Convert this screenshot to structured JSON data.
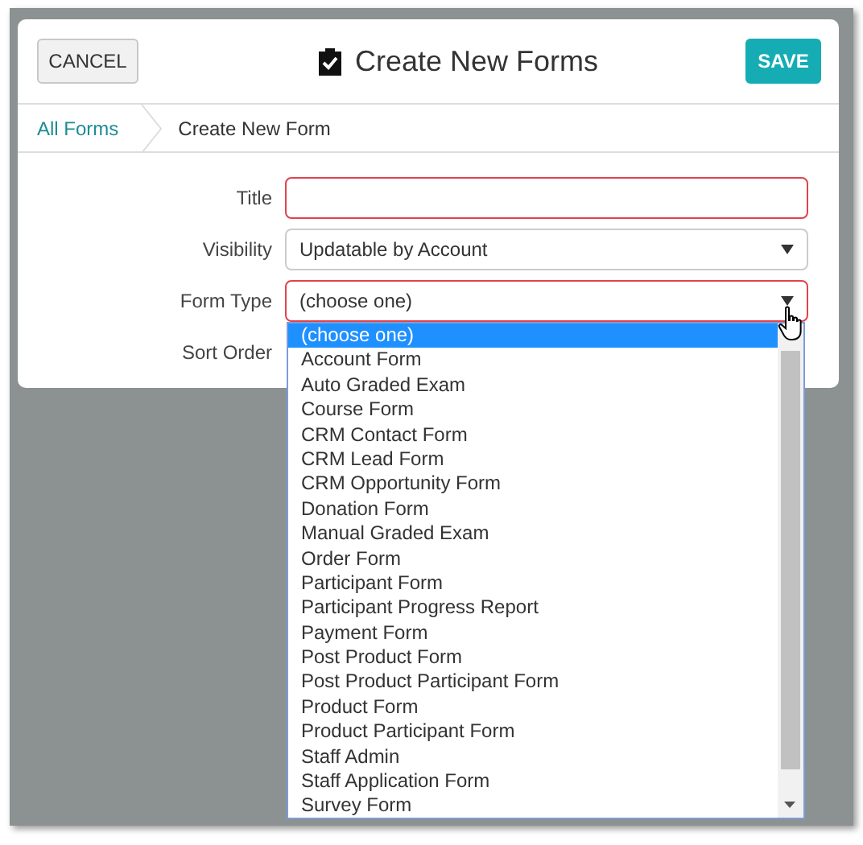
{
  "header": {
    "cancel": "CANCEL",
    "title": "Create New Forms",
    "save": "SAVE"
  },
  "breadcrumb": [
    {
      "label": "All Forms",
      "kind": "link"
    },
    {
      "label": "Create New Form",
      "kind": "current"
    }
  ],
  "fields": [
    {
      "label": "Title",
      "kind": "text",
      "invalid": true
    },
    {
      "label": "Visibility",
      "kind": "select",
      "value": "Updatable by Account",
      "invalid": false
    },
    {
      "label": "Form Type",
      "kind": "select",
      "value": "(choose one)",
      "invalid": true,
      "expanded": true
    },
    {
      "label": "Sort Order",
      "kind": "covered"
    }
  ],
  "options": [
    {
      "label": "(choose one)",
      "selected": true
    },
    {
      "label": "Account Form",
      "selected": false
    },
    {
      "label": "Auto Graded Exam",
      "selected": false
    },
    {
      "label": "Course Form",
      "selected": false
    },
    {
      "label": "CRM Contact Form",
      "selected": false
    },
    {
      "label": "CRM Lead Form",
      "selected": false
    },
    {
      "label": "CRM Opportunity Form",
      "selected": false
    },
    {
      "label": "Donation Form",
      "selected": false
    },
    {
      "label": "Manual Graded Exam",
      "selected": false
    },
    {
      "label": "Order Form",
      "selected": false
    },
    {
      "label": "Participant Form",
      "selected": false
    },
    {
      "label": "Participant Progress Report",
      "selected": false
    },
    {
      "label": "Payment Form",
      "selected": false
    },
    {
      "label": "Post Product Form",
      "selected": false
    },
    {
      "label": "Post Product Participant Form",
      "selected": false
    },
    {
      "label": "Product Form",
      "selected": false
    },
    {
      "label": "Product Participant Form",
      "selected": false
    },
    {
      "label": "Staff Admin",
      "selected": false
    },
    {
      "label": "Staff Application Form",
      "selected": false
    },
    {
      "label": "Survey Form",
      "selected": false
    }
  ]
}
